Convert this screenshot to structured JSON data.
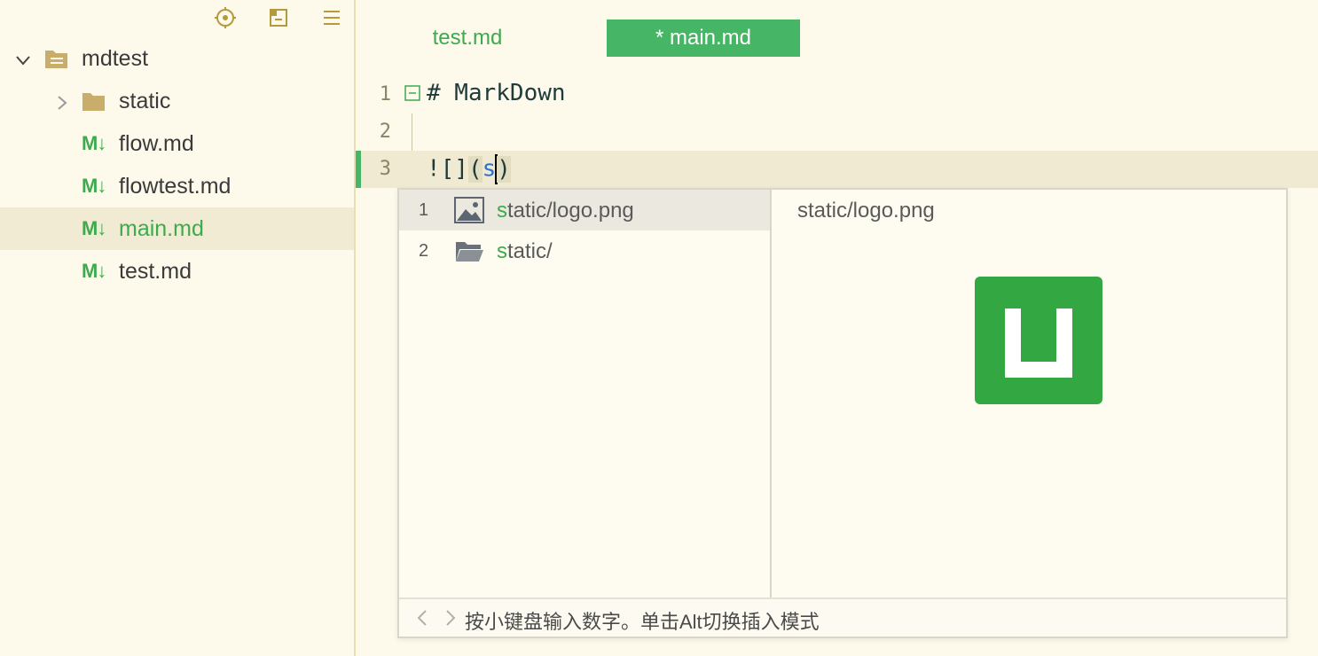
{
  "sidebar": {
    "toolbar": [
      {
        "icon": "locate-icon"
      },
      {
        "icon": "collapse-all-icon"
      },
      {
        "icon": "menu-icon"
      }
    ],
    "root": {
      "label": "mdtest",
      "expanded": true
    },
    "items": [
      {
        "label": "static",
        "type": "folder",
        "expanded": false
      },
      {
        "label": "flow.md",
        "type": "markdown"
      },
      {
        "label": "flowtest.md",
        "type": "markdown"
      },
      {
        "label": "main.md",
        "type": "markdown",
        "selected": true
      },
      {
        "label": "test.md",
        "type": "markdown"
      }
    ],
    "md_icon_text": "M↓"
  },
  "editor": {
    "tabs": [
      {
        "label": "test.md",
        "active": false
      },
      {
        "label": "* main.md",
        "active": true
      }
    ],
    "lines": [
      {
        "num": "1",
        "text": "# MarkDown"
      },
      {
        "num": "2",
        "text": ""
      },
      {
        "num": "3",
        "prefix": "![]",
        "open": "(",
        "typed": "s",
        "close": ")"
      }
    ]
  },
  "completion": {
    "items": [
      {
        "num": "1",
        "match": "s",
        "rest": "tatic/logo.png",
        "icon": "image-file-icon",
        "selected": true
      },
      {
        "num": "2",
        "match": "s",
        "rest": "tatic/",
        "icon": "folder-open-icon",
        "selected": false
      }
    ],
    "preview_title": "static/logo.png",
    "footer_text": "按小键盘输入数字。单击Alt切换插入模式"
  },
  "colors": {
    "accent": "#46b565",
    "background": "#fdfaec",
    "folder": "#c9ad6a",
    "logo": "#33a842"
  }
}
